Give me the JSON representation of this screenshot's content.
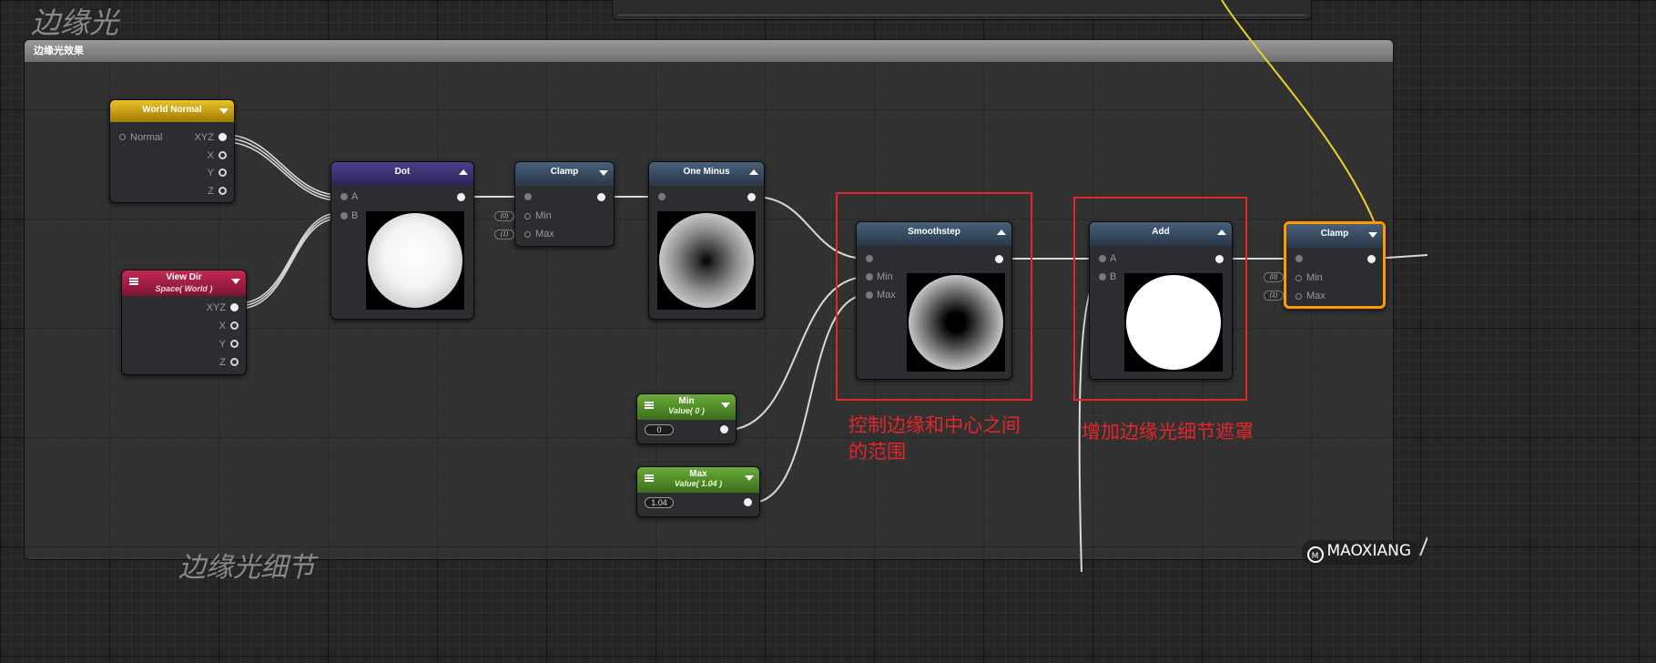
{
  "groups": {
    "main_title": "边缘光",
    "frame_title": "边缘光效果",
    "bottom_title": "边缘光细节"
  },
  "nodes": {
    "world_normal": {
      "title": "World Normal",
      "input": "Normal",
      "outputs": [
        "XYZ",
        "X",
        "Y",
        "Z"
      ]
    },
    "view_dir": {
      "title": "View Dir",
      "subtitle": "Space( World )",
      "outputs": [
        "XYZ",
        "X",
        "Y",
        "Z"
      ]
    },
    "dot": {
      "title": "Dot",
      "inputs": [
        "A",
        "B"
      ]
    },
    "clamp1": {
      "title": "Clamp",
      "inputs": [
        "Min",
        "Max"
      ],
      "tags": [
        "(0)",
        "(1)"
      ]
    },
    "one_minus": {
      "title": "One Minus"
    },
    "smoothstep": {
      "title": "Smoothstep",
      "inputs": [
        "Min",
        "Max"
      ]
    },
    "min_value": {
      "title": "Min",
      "subtitle": "Value( 0 )",
      "value": "0"
    },
    "max_value": {
      "title": "Max",
      "subtitle": "Value( 1.04 )",
      "value": "1.04"
    },
    "add": {
      "title": "Add",
      "inputs": [
        "A",
        "B"
      ]
    },
    "clamp2": {
      "title": "Clamp",
      "inputs": [
        "Min",
        "Max"
      ],
      "tags": [
        "(0)",
        "(1)"
      ]
    }
  },
  "annotations": {
    "smoothstep_note_line1": "控制边缘和中心之间",
    "smoothstep_note_line2": "的范围",
    "add_note": "增加边缘光细节遮罩"
  },
  "watermark": {
    "logo": "M",
    "text": "MAOXIANG"
  },
  "colors": {
    "annotation_red": "#e5252a",
    "selected_orange": "#ff9a00",
    "wire_yellow": "#e6d22a",
    "wire_white": "#d9d9d9"
  }
}
